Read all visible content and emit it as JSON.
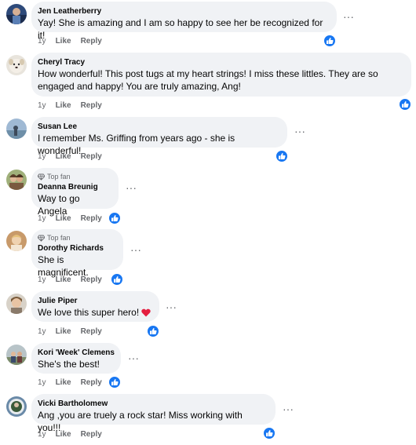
{
  "comments": [
    {
      "author": "Jen Leatherberry",
      "text": "Yay! She is amazing and I am so happy to see her be recognized for it!",
      "time": "1y",
      "like": "Like",
      "reply": "Reply",
      "top_fan": ""
    },
    {
      "author": "Cheryl Tracy",
      "text": "How wonderful! This post tugs at my heart strings! I miss these littles. They are so engaged and happy! You are truly amazing, Ang!",
      "time": "1y",
      "like": "Like",
      "reply": "Reply",
      "top_fan": ""
    },
    {
      "author": "Susan Lee",
      "text": "I remember Ms. Griffing from years ago - she is wonderful!",
      "time": "1y",
      "like": "Like",
      "reply": "Reply",
      "top_fan": ""
    },
    {
      "author": "Deanna Breunig",
      "text": "Way to go Angela",
      "time": "1y",
      "like": "Like",
      "reply": "Reply",
      "top_fan": "Top fan"
    },
    {
      "author": "Dorothy Richards",
      "text": "She is magnificent.",
      "time": "1y",
      "like": "Like",
      "reply": "Reply",
      "top_fan": "Top fan"
    },
    {
      "author": "Julie Piper",
      "text": "We love this super hero!",
      "time": "1y",
      "like": "Like",
      "reply": "Reply",
      "top_fan": ""
    },
    {
      "author": "Kori 'Week' Clemens",
      "text": "She's the best!",
      "time": "1y",
      "like": "Like",
      "reply": "Reply",
      "top_fan": ""
    },
    {
      "author": "Vicki Bartholomew",
      "text": "Ang ,you are truely a rock star! Miss working with you!!!",
      "time": "1y",
      "like": "Like",
      "reply": "Reply",
      "top_fan": ""
    }
  ],
  "icons": {
    "more": "more-options-icon",
    "like_reaction": "thumbs-up-icon",
    "top_fan": "diamond-icon",
    "heart": "red-heart-emoji"
  },
  "colors": {
    "bubble": "#f0f2f5",
    "like_blue": "#1877f2",
    "secondary_text": "#65676b",
    "heart": "#e41e3f"
  },
  "more_glyph": "···"
}
